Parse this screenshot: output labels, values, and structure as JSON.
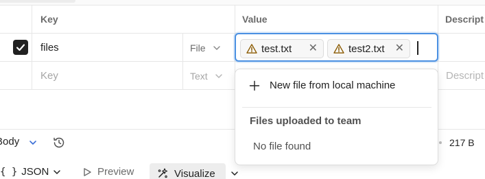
{
  "table": {
    "headers": {
      "key": "Key",
      "value": "Value",
      "description": "Descript"
    },
    "rows": [
      {
        "checked": true,
        "key": "files",
        "type": "File",
        "files": [
          {
            "name": "test.txt",
            "status": "warning"
          },
          {
            "name": "test2.txt",
            "status": "warning"
          }
        ]
      },
      {
        "checked": false,
        "key_placeholder": "Key",
        "type": "Text",
        "description_placeholder": "Descript"
      }
    ]
  },
  "dropdown": {
    "new_file_label": "New file from local machine",
    "section_heading": "Files uploaded to team",
    "empty_text": "No file found"
  },
  "response_bar": {
    "body_label": "Body",
    "size": "217 B"
  },
  "view_bar": {
    "format_label": "JSON",
    "preview_label": "Preview",
    "visualize_label": "Visualize"
  },
  "colors": {
    "focus_border": "#4a90e2",
    "checkbox_fill": "#212121",
    "warning": "#b26a00"
  }
}
